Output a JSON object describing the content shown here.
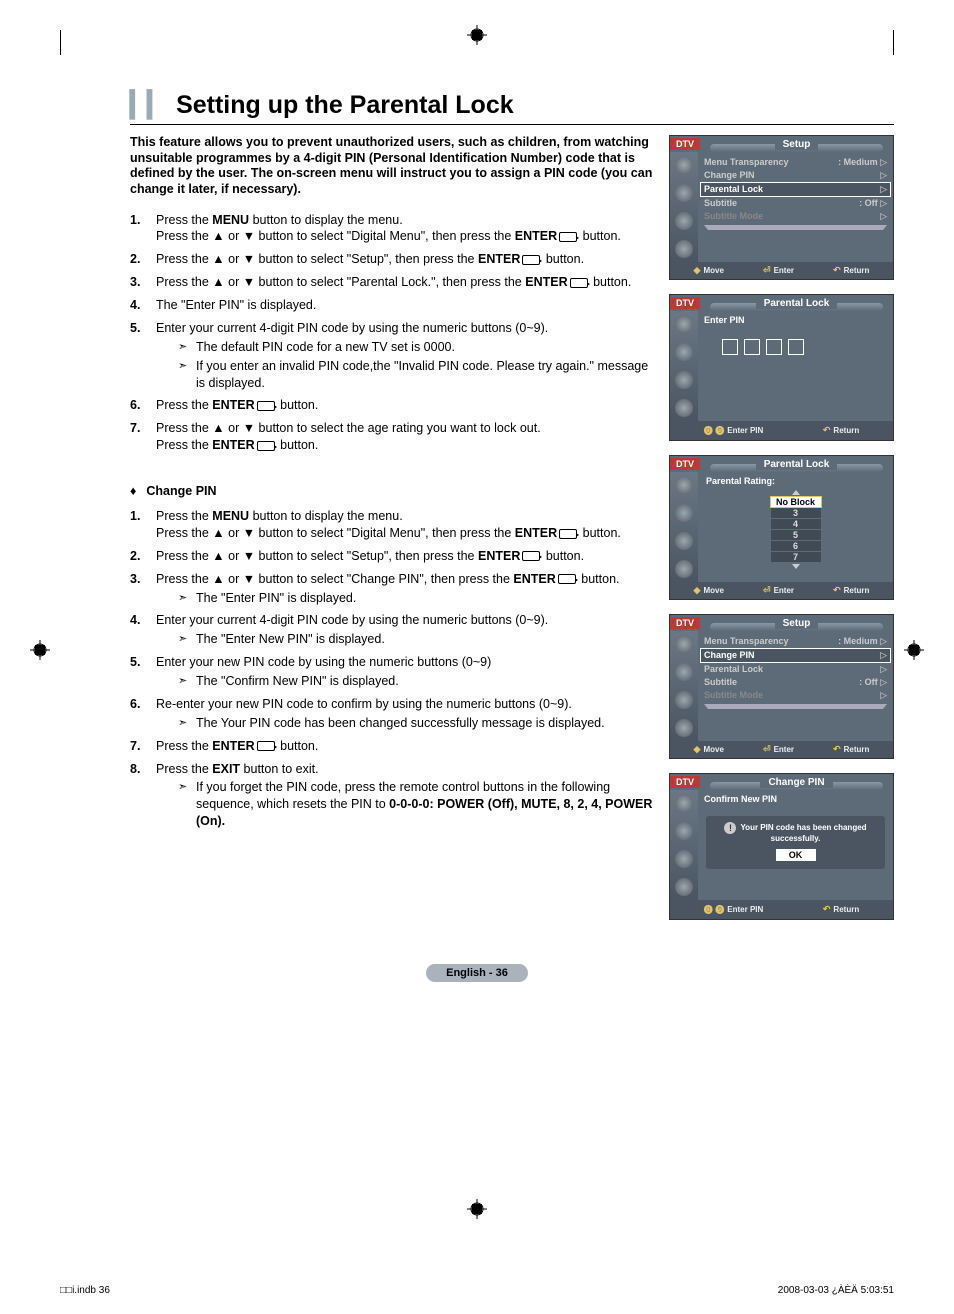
{
  "page_title": "Setting up the Parental Lock",
  "intro": "This feature allows you to prevent unauthorized users, such as children, from watching unsuitable programmes by a 4-digit PIN (Personal Identification Number) code that is defined by the user.  The on-screen menu will instruct you to assign a PIN code (you can change it later, if necessary).",
  "steps_a": [
    {
      "n": "1.",
      "body_a": "Press the ",
      "bold_a": "MENU",
      "body_b": " button to display the menu.",
      "line2_a": "Press the ▲ or ▼ button to select \"Digital Menu\", then press the ",
      "bold_b": "ENTER",
      "line2_b": " button."
    },
    {
      "n": "2.",
      "body_a": "Press the ▲ or ▼ button to select \"Setup\", then press the ",
      "bold_a": "ENTER",
      "body_b": " button."
    },
    {
      "n": "3.",
      "body_a": "Press the ▲ or ▼ button to select \"Parental Lock.\", then press the ",
      "bold_a": "ENTER",
      "body_b": " button."
    },
    {
      "n": "4.",
      "body_a": "The \"Enter PIN\" is displayed."
    },
    {
      "n": "5.",
      "body_a": "Enter your current 4-digit PIN code by using the numeric buttons (0~9).",
      "notes": [
        "The default PIN code for a new TV set is 0000.",
        "If you enter an invalid PIN code,the \"Invalid PIN code. Please try again.\" message is displayed."
      ]
    },
    {
      "n": "6.",
      "body_a": "Press the ",
      "bold_a": "ENTER",
      "body_b": " button."
    },
    {
      "n": "7.",
      "body_a": "Press the ▲ or ▼ button to select the age rating you want to lock out.",
      "line2_a": "Press the ",
      "bold_b": "ENTER",
      "line2_b": " button."
    }
  ],
  "section_b_title": "Change PIN",
  "steps_b": [
    {
      "n": "1.",
      "body_a": "Press the ",
      "bold_a": "MENU",
      "body_b": " button to display the menu.",
      "line2_a": "Press the ▲ or ▼ button to select \"Digital Menu\", then press the ",
      "bold_b": "ENTER",
      "line2_b": " button."
    },
    {
      "n": "2.",
      "body_a": "Press the ▲ or ▼ button to select \"Setup\", then press the ",
      "bold_a": "ENTER",
      "body_b": " button."
    },
    {
      "n": "3.",
      "body_a": "Press the ▲ or ▼ button to select \"Change PIN\", then press the ",
      "bold_a": "ENTER",
      "body_b": " button.",
      "notes": [
        "The \"Enter PIN\" is displayed."
      ]
    },
    {
      "n": "4.",
      "body_a": "Enter your current 4-digit PIN code by using the numeric buttons (0~9).",
      "notes": [
        "The \"Enter New PIN\" is displayed."
      ]
    },
    {
      "n": "5.",
      "body_a": "Enter your new PIN code by using the numeric buttons (0~9)",
      "notes": [
        "The \"Confirm New PIN\" is displayed."
      ]
    },
    {
      "n": "6.",
      "body_a": "Re-enter your new PIN code to confirm by using the numeric buttons (0~9).",
      "notes": [
        "The Your PIN code has been changed successfully message is displayed."
      ]
    },
    {
      "n": "7.",
      "body_a": "Press the ",
      "bold_a": "ENTER",
      "body_b": " button."
    },
    {
      "n": "8.",
      "body_a": "Press the ",
      "bold_a": "EXIT",
      "body_b": " button to exit.",
      "notes": [
        "If you forget the PIN code, press the remote control buttons in the following sequence, which resets the PIN to <b>0-0-0-0: POWER (Off), MUTE, 8, 2, 4, POWER (On).</b>"
      ]
    }
  ],
  "osd": {
    "dtv": "DTV",
    "setup_title": "Setup",
    "parental_title": "Parental Lock",
    "changepin_title": "Change PIN",
    "menu1": [
      {
        "l": "Menu Transparency",
        "v": ": Medium",
        "sel": false
      },
      {
        "l": "Change PIN",
        "v": "",
        "sel": false
      },
      {
        "l": "Parental Lock",
        "v": "",
        "sel": true
      },
      {
        "l": "Subtitle",
        "v": ": Off",
        "sel": false
      },
      {
        "l": "Subtitle  Mode",
        "v": "",
        "sel": false,
        "dim": true
      }
    ],
    "menu4": [
      {
        "l": "Menu Transparency",
        "v": ": Medium",
        "sel": false
      },
      {
        "l": "Change PIN",
        "v": "",
        "sel": true
      },
      {
        "l": "Parental Lock",
        "v": "",
        "sel": false
      },
      {
        "l": "Subtitle",
        "v": ": Off",
        "sel": false
      },
      {
        "l": "Subtitle  Mode",
        "v": "",
        "sel": false,
        "dim": true
      }
    ],
    "enter_pin": "Enter PIN",
    "confirm_new_pin": "Confirm New PIN",
    "parental_rating": "Parental Rating:",
    "rating_items": [
      "No Block",
      "3",
      "4",
      "5",
      "6",
      "7"
    ],
    "success_msg": "Your PIN code has been changed successfully.",
    "ok": "OK",
    "footer": {
      "move": "Move",
      "enter": "Enter",
      "return": "Return",
      "enterpin": "Enter PIN"
    }
  },
  "footer_pill": "English - 36",
  "footer_left": "□□i.indb   36",
  "footer_right": "2008-03-03   ¿ÀÈÄ 5:03:51"
}
